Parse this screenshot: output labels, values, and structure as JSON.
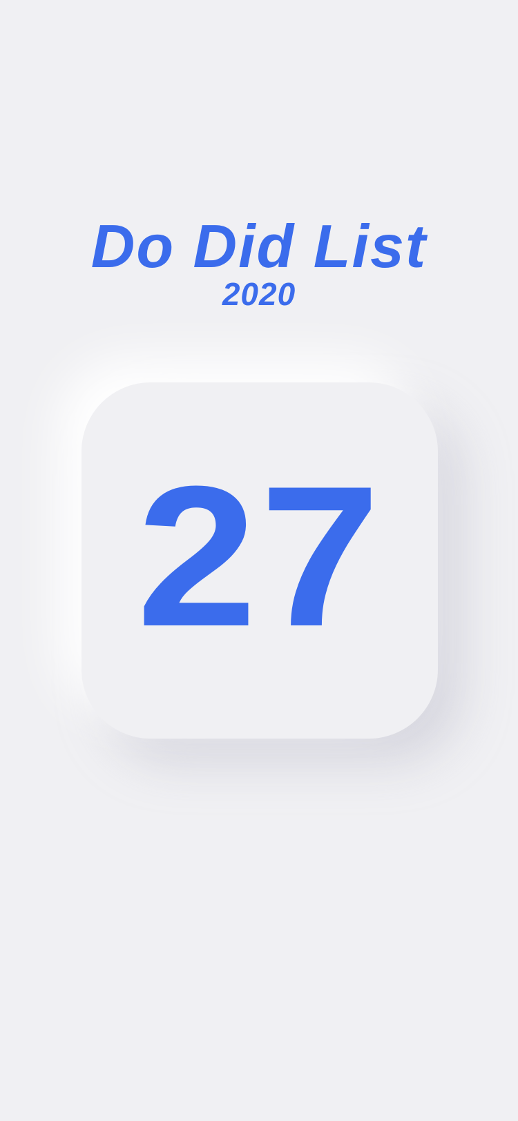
{
  "app": {
    "title": "Do Did List",
    "year": "2020"
  },
  "counter": {
    "value": "27"
  },
  "colors": {
    "background": "#f0f0f3",
    "accent": "#3b6cec",
    "shadow_light": "#ffffff",
    "shadow_dark": "#aeaec0"
  }
}
